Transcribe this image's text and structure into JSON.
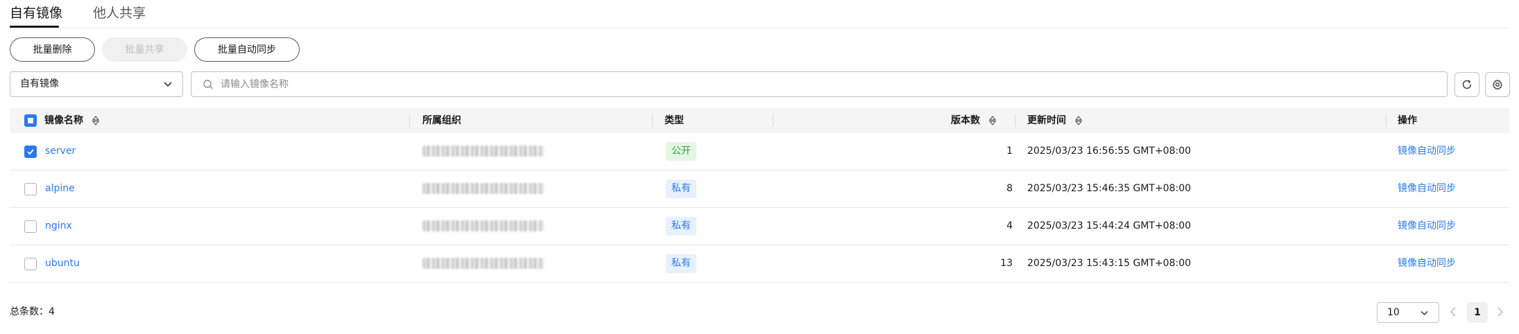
{
  "tabs": [
    {
      "label": "自有镜像",
      "active": true
    },
    {
      "label": "他人共享",
      "active": false
    }
  ],
  "toolbar": {
    "batch_delete": "批量删除",
    "batch_share": "批量共享",
    "batch_auto_sync": "批量自动同步"
  },
  "filter": {
    "selected": "自有镜像",
    "search_placeholder": "请输入镜像名称"
  },
  "table": {
    "columns": {
      "name": "镜像名称",
      "org": "所属组织",
      "type": "类型",
      "versions": "版本数",
      "updated": "更新时间",
      "actions": "操作"
    },
    "rows": [
      {
        "name": "server",
        "checked": true,
        "type": "公开",
        "versions": "1",
        "updated": "2025/03/23 16:56:55 GMT+08:00",
        "action": "镜像自动同步"
      },
      {
        "name": "alpine",
        "checked": false,
        "type": "私有",
        "versions": "8",
        "updated": "2025/03/23 15:46:35 GMT+08:00",
        "action": "镜像自动同步"
      },
      {
        "name": "nginx",
        "checked": false,
        "type": "私有",
        "versions": "4",
        "updated": "2025/03/23 15:44:24 GMT+08:00",
        "action": "镜像自动同步"
      },
      {
        "name": "ubuntu",
        "checked": false,
        "type": "私有",
        "versions": "13",
        "updated": "2025/03/23 15:43:15 GMT+08:00",
        "action": "镜像自动同步"
      }
    ]
  },
  "footer": {
    "total": "总条数：4",
    "page_size": "10",
    "current_page": "1"
  },
  "colors": {
    "accent": "#2c78f0",
    "public_tag_bg": "#e4f7e4",
    "public_tag_text": "#2ea044",
    "private_tag_bg": "#e6f1fd"
  }
}
